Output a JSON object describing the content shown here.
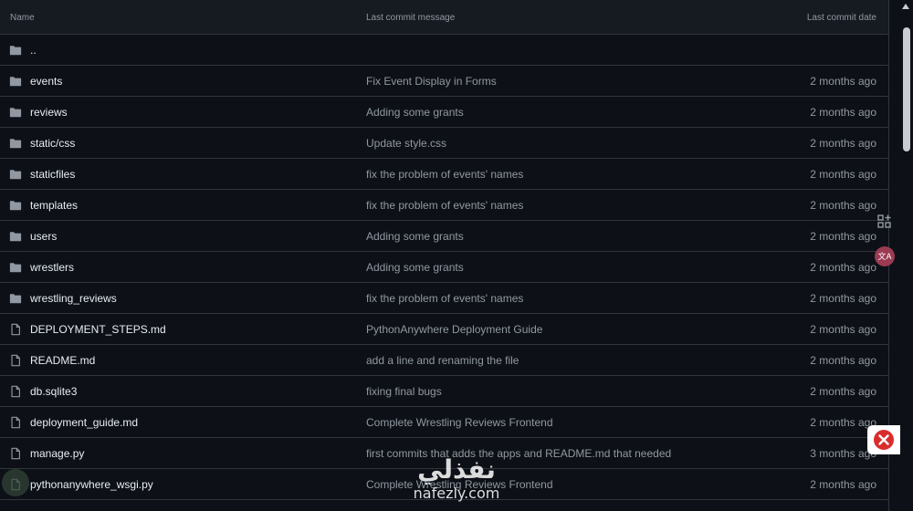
{
  "header": {
    "name": "Name",
    "message": "Last commit message",
    "date": "Last commit date"
  },
  "rows": [
    {
      "type": "folder",
      "name": "..",
      "message": "",
      "date": ""
    },
    {
      "type": "folder",
      "name": "events",
      "message": "Fix Event Display in Forms",
      "date": "2 months ago"
    },
    {
      "type": "folder",
      "name": "reviews",
      "message": "Adding some grants",
      "date": "2 months ago"
    },
    {
      "type": "folder",
      "name": "static/css",
      "message": "Update style.css",
      "date": "2 months ago"
    },
    {
      "type": "folder",
      "name": "staticfiles",
      "message": "fix the problem of events' names",
      "date": "2 months ago"
    },
    {
      "type": "folder",
      "name": "templates",
      "message": "fix the problem of events' names",
      "date": "2 months ago"
    },
    {
      "type": "folder",
      "name": "users",
      "message": "Adding some grants",
      "date": "2 months ago"
    },
    {
      "type": "folder",
      "name": "wrestlers",
      "message": "Adding some grants",
      "date": "2 months ago"
    },
    {
      "type": "folder",
      "name": "wrestling_reviews",
      "message": "fix the problem of events' names",
      "date": "2 months ago"
    },
    {
      "type": "file",
      "name": "DEPLOYMENT_STEPS.md",
      "message": "PythonAnywhere Deployment Guide",
      "date": "2 months ago"
    },
    {
      "type": "file",
      "name": "README.md",
      "message": "add a line and renaming the file",
      "date": "2 months ago"
    },
    {
      "type": "file",
      "name": "db.sqlite3",
      "message": "fixing final bugs",
      "date": "2 months ago"
    },
    {
      "type": "file",
      "name": "deployment_guide.md",
      "message": "Complete Wrestling Reviews Frontend",
      "date": "2 months ago"
    },
    {
      "type": "file",
      "name": "manage.py",
      "message": "first commits that adds the apps and README.md that needed",
      "date": "3 months ago"
    },
    {
      "type": "file",
      "name": "pythonanywhere_wsgi.py",
      "message": "Complete Wrestling Reviews Frontend",
      "date": "2 months ago"
    }
  ],
  "watermark": {
    "arabic": "نفذلي",
    "latin": "nafezly.com"
  },
  "side": {
    "translate_label": "文A"
  },
  "colors": {
    "background": "#0d1117",
    "header_bg": "#161b22",
    "border": "#30363d",
    "muted_text": "#9198a1",
    "text": "#e6edf3",
    "translate_bg": "#9b3b52",
    "close_red": "#d92d2d"
  }
}
